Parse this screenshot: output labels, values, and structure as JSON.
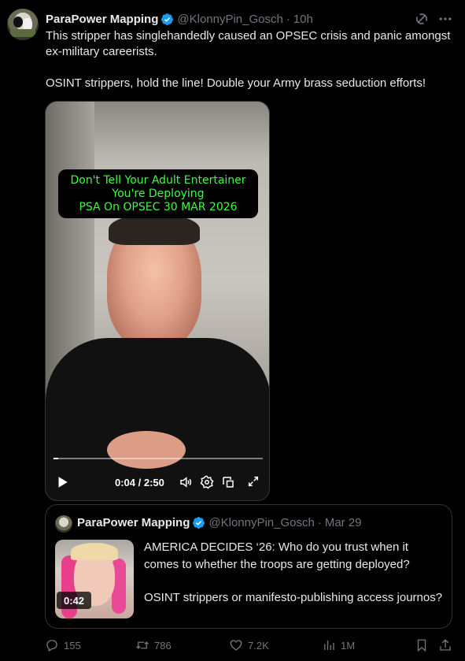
{
  "tweet": {
    "author_name": "ParaPower Mapping",
    "handle": "@KlonnyPin_Gosch",
    "separator": "·",
    "time": "10h",
    "text_p1": "This stripper has singlehandedly caused an OPSEC crisis and panic amongst ex-military careerists.",
    "text_p2": "OSINT strippers, hold the line! Double your Army brass seduction efforts!"
  },
  "video": {
    "caption_line1": "Don't Tell Your Adult Entertainer",
    "caption_line2": "You're Deploying",
    "caption_line3": "PSA On OPSEC 30 MAR 2026",
    "time_display": "0:04 / 2:50",
    "progress_fraction": 0.024
  },
  "quote": {
    "author_name": "ParaPower Mapping",
    "handle": "@KlonnyPin_Gosch",
    "separator": "·",
    "date": "Mar 29",
    "text_p1": "AMERICA DECIDES ‘26: Who do you trust when it comes to whether the troops are getting deployed?",
    "text_p2": "OSINT strippers or manifesto-publishing access journos?",
    "video_duration": "0:42"
  },
  "actions": {
    "replies": "155",
    "reposts": "786",
    "likes": "7.2K",
    "views": "1M"
  },
  "colors": {
    "background": "#000000",
    "text": "#e7e9ea",
    "muted": "#71767b",
    "verified": "#1d9bf0",
    "caption": "#3cff3c"
  },
  "icons": [
    "verified-badge-icon",
    "grok-icon",
    "more-icon",
    "play-icon",
    "volume-icon",
    "settings-icon",
    "captions-icon",
    "fullscreen-icon",
    "reply-icon",
    "repost-icon",
    "like-icon",
    "views-icon",
    "bookmark-icon",
    "share-icon"
  ]
}
